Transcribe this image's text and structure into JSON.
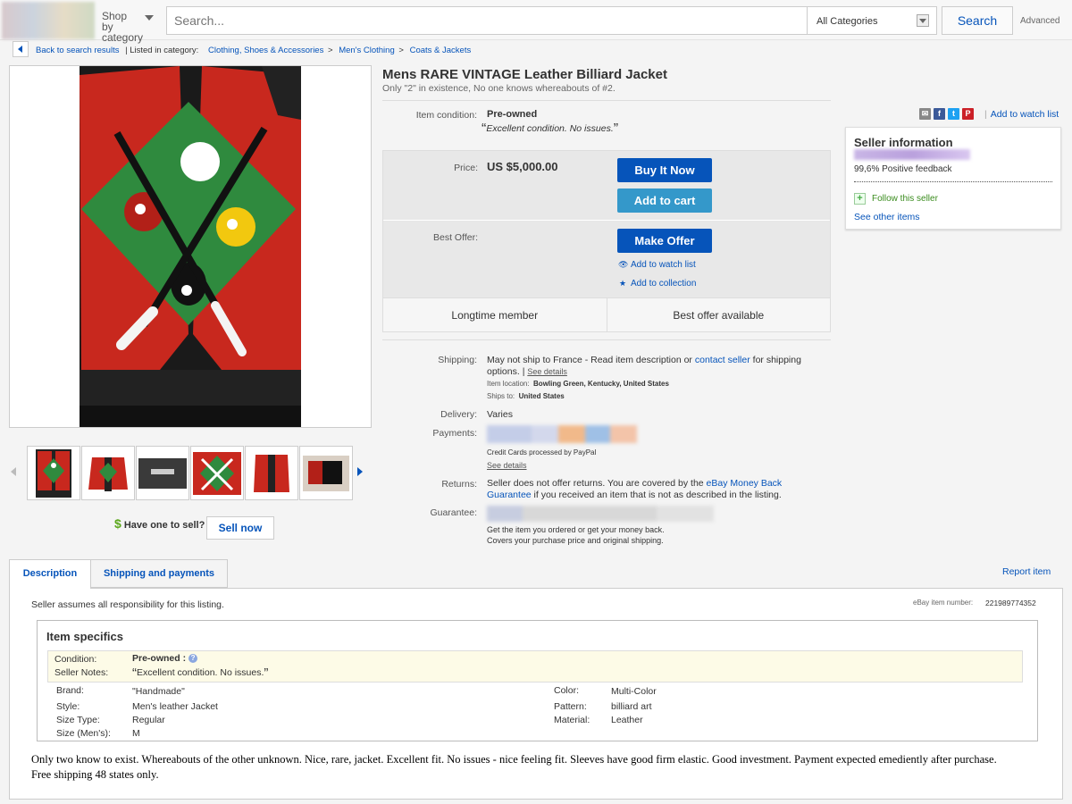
{
  "header": {
    "shop_by_category": "Shop by category",
    "search_placeholder": "Search...",
    "category_select": "All Categories",
    "search_button": "Search",
    "advanced": "Advanced"
  },
  "breadcrumb": {
    "back": "Back to search results",
    "listed_in": "| Listed in category:",
    "crumbs": [
      "Clothing, Shoes & Accessories",
      ">",
      "Men's Clothing",
      ">",
      "Coats & Jackets"
    ]
  },
  "item": {
    "title": "Mens RARE VINTAGE Leather Billiard Jacket",
    "subtitle": "Only \"2\" in existence, No one knows whereabouts of #2.",
    "condition_label": "Item condition:",
    "condition_value": "Pre-owned",
    "condition_notes": "Excellent condition. No issues."
  },
  "buybox": {
    "price_label": "Price:",
    "price_value": "US $5,000.00",
    "buy_now": "Buy It Now",
    "add_to_cart": "Add to cart",
    "best_offer_label": "Best Offer:",
    "make_offer": "Make Offer",
    "add_watch": "Add to watch list",
    "add_collection": "Add to collection",
    "tile_left": "Longtime member",
    "tile_right": "Best offer available"
  },
  "shipping": {
    "label": "Shipping:",
    "text_1": "May not ship to France - Read item description or ",
    "contact_link": "contact seller",
    "text_2": " for shipping",
    "text_3": "options. |",
    "see_details": "See details",
    "location_label": "Item location:",
    "location_value": "Bowling Green, Kentucky, United States",
    "ships_to_label": "Ships to:",
    "ships_to_value": "United States"
  },
  "delivery": {
    "label": "Delivery:",
    "value": "Varies"
  },
  "payments": {
    "label": "Payments:",
    "note": "Credit Cards processed by PayPal",
    "see_details": "See details"
  },
  "returns": {
    "label": "Returns:",
    "text_1": "Seller does not offer returns. You are covered by the ",
    "link_1": "eBay Money Back",
    "link_2": "Guarantee",
    "text_2": " if you received an item that is not as described in the listing."
  },
  "guarantee": {
    "label": "Guarantee:",
    "line_1": "Get the item you ordered or get your money back.",
    "line_2": "Covers your purchase price and original shipping."
  },
  "seller": {
    "watch_top": "Add to watch list",
    "title": "Seller information",
    "feedback": "99,6% Positive feedback",
    "follow": "Follow this seller",
    "see_other": "See other items"
  },
  "tabs": {
    "description": "Description",
    "shipping_payments": "Shipping and payments",
    "report": "Report item"
  },
  "description": {
    "responsibility": "Seller assumes all responsibility for this listing.",
    "item_number_label": "eBay item number:",
    "item_number": "221989774352",
    "specs_title": "Item specifics",
    "condition_label": "Condition:",
    "condition_value": "Pre-owned :",
    "notes_label": "Seller Notes:",
    "notes_value": "Excellent condition. No issues.",
    "specs": {
      "brand_label": "Brand:",
      "brand_value": "\"Handmade\"",
      "style_label": "Style:",
      "style_value": "Men's leather Jacket",
      "size_type_label": "Size Type:",
      "size_type_value": "Regular",
      "size_label": "Size (Men's):",
      "size_value": "M",
      "color_label": "Color:",
      "color_value": "Multi-Color",
      "pattern_label": "Pattern:",
      "pattern_value": "billiard art",
      "material_label": "Material:",
      "material_value": "Leather"
    },
    "body": "Only two know to exist. Whereabouts of the other unknown. Nice, rare, jacket. Excellent fit. No issues - nice feeling fit. Sleeves have good firm elastic. Good investment. Payment expected emediently after purchase. Free shipping 48 states only."
  },
  "sell": {
    "label": "Have one to sell?",
    "button": "Sell now"
  }
}
